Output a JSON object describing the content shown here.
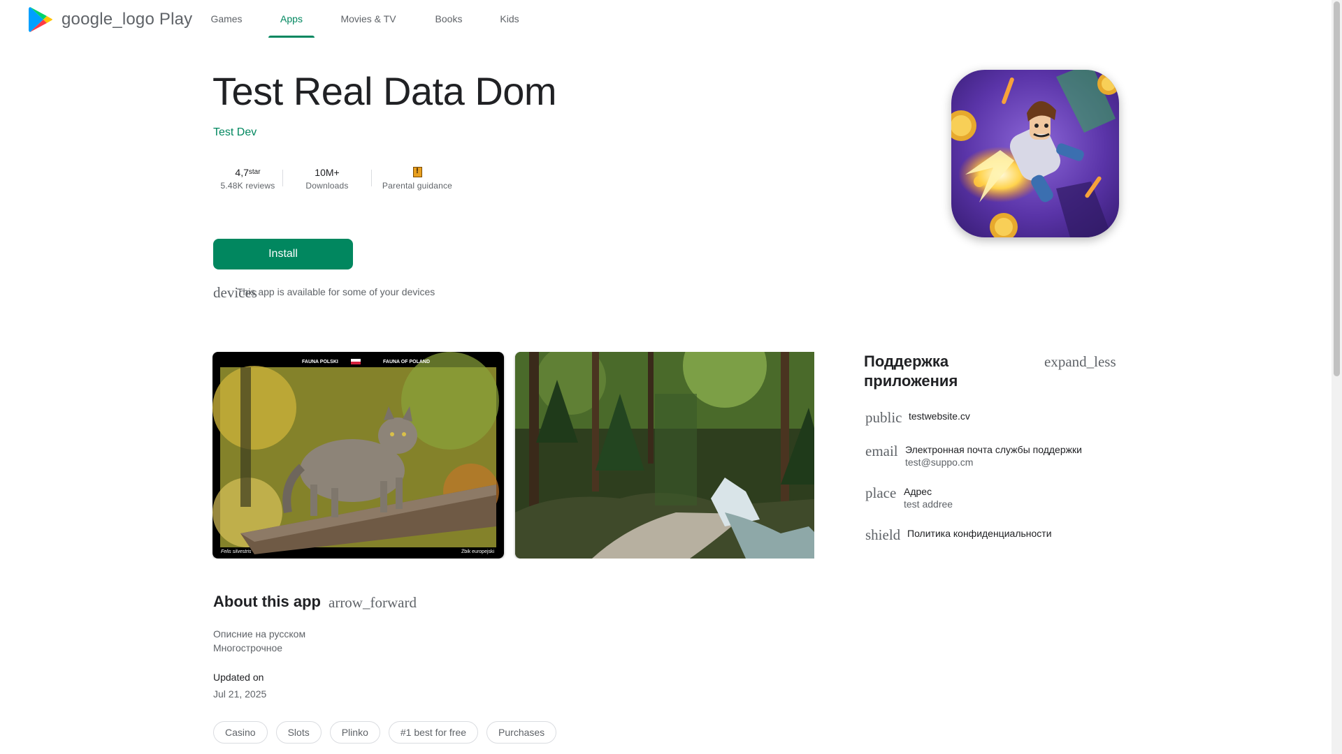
{
  "header": {
    "logo_text": "google_logo Play",
    "nav": [
      {
        "label": "Games",
        "active": false
      },
      {
        "label": "Apps",
        "active": true
      },
      {
        "label": "Movies & TV",
        "active": false
      },
      {
        "label": "Books",
        "active": false
      },
      {
        "label": "Kids",
        "active": false
      }
    ],
    "accent_color": "#01875f"
  },
  "app": {
    "title": "Test Real Data Dom",
    "developer": "Test Dev",
    "icon": "jetpack-hero-app-icon",
    "stats": {
      "rating": "4,7",
      "rating_unit": "star",
      "reviews": "5.48K reviews",
      "downloads": "10M+",
      "downloads_label": "Downloads",
      "content_rating_icon": "parental-guidance-badge-icon",
      "content_rating_label": "Parental guidance"
    },
    "install_label": "Install",
    "devices_icon_text": "devices",
    "devices_text": "This app is available for some of your devices"
  },
  "screenshots": [
    {
      "name": "wildcat-screenshot",
      "caption_left": "FAUNA POLSKI",
      "caption_right": "FAUNA OF POLAND",
      "footer_left": "Felis silvestris",
      "footer_right": "Żbik europejski"
    },
    {
      "name": "forest-waterfall-screenshot"
    }
  ],
  "support": {
    "title": "Поддержка приложения",
    "toggle_icon_text": "expand_less",
    "items": [
      {
        "icon": "public",
        "label": "testwebsite.cv",
        "value": ""
      },
      {
        "icon": "email",
        "label": "Электронная почта службы поддержки",
        "value": "test@suppo.cm"
      },
      {
        "icon": "place",
        "label": "Адрес",
        "value": "test addree"
      },
      {
        "icon": "shield",
        "label": "Политика конфиденциальности",
        "value": ""
      }
    ]
  },
  "about": {
    "title": "About this app",
    "arrow_icon_text": "arrow_forward",
    "description_lines": [
      "Описние на русском",
      "Многострочное"
    ],
    "updated_label": "Updated on",
    "updated_value": "Jul 21, 2025",
    "chips": [
      "Casino",
      "Slots",
      "Plinko",
      "#1 best for free",
      "Purchases"
    ]
  }
}
